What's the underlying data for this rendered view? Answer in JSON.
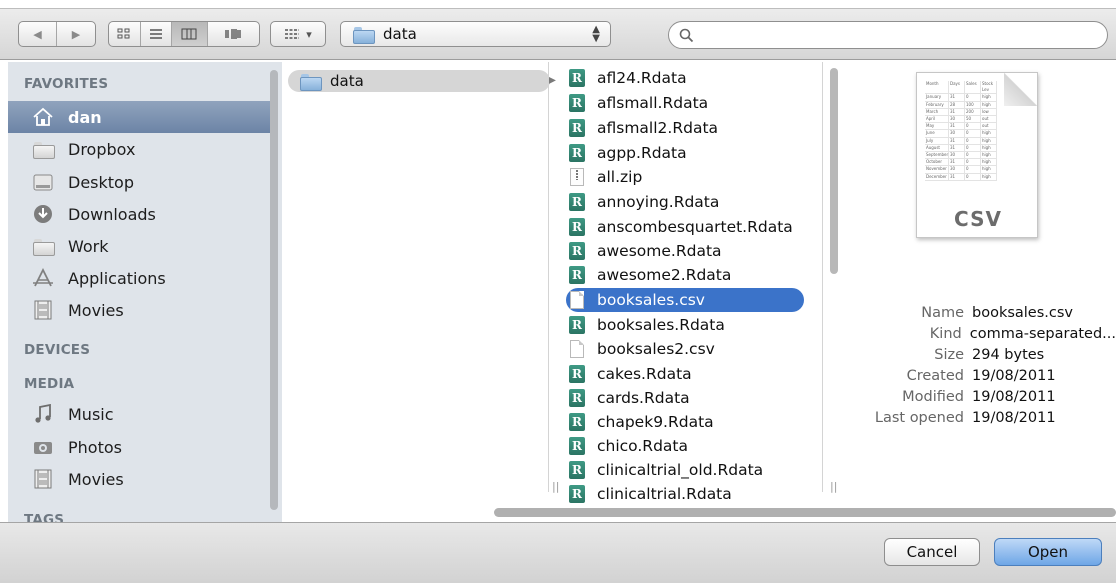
{
  "toolbar": {
    "nav_back_glyph": "◀",
    "nav_forward_glyph": "▶",
    "view_modes": [
      "icon",
      "list",
      "column",
      "coverflow"
    ],
    "active_view": "column",
    "arrange_glyph": "▾",
    "path_folder": "data",
    "search_value": "",
    "search_placeholder": ""
  },
  "sidebar": {
    "favorites_heading": "FAVORITES",
    "favorites": [
      {
        "label": "dan",
        "icon": "home-icon",
        "selected": true
      },
      {
        "label": "Dropbox",
        "icon": "folder-icon"
      },
      {
        "label": "Desktop",
        "icon": "desktop-icon"
      },
      {
        "label": "Downloads",
        "icon": "downloads-icon"
      },
      {
        "label": "Work",
        "icon": "folder-icon"
      },
      {
        "label": "Applications",
        "icon": "applications-icon"
      },
      {
        "label": "Movies",
        "icon": "movies-icon"
      }
    ],
    "devices_heading": "DEVICES",
    "media_heading": "MEDIA",
    "media": [
      {
        "label": "Music",
        "icon": "music-icon"
      },
      {
        "label": "Photos",
        "icon": "camera-icon"
      },
      {
        "label": "Movies",
        "icon": "movies-icon"
      }
    ],
    "tags_heading": "TAGS"
  },
  "columns": {
    "col1_folder": "data",
    "files": [
      {
        "name": "afl24.Rdata",
        "type": "rdata"
      },
      {
        "name": "aflsmall.Rdata",
        "type": "rdata"
      },
      {
        "name": "aflsmall2.Rdata",
        "type": "rdata"
      },
      {
        "name": "agpp.Rdata",
        "type": "rdata"
      },
      {
        "name": "all.zip",
        "type": "zip"
      },
      {
        "name": "annoying.Rdata",
        "type": "rdata"
      },
      {
        "name": "anscombesquartet.Rdata",
        "type": "rdata"
      },
      {
        "name": "awesome.Rdata",
        "type": "rdata"
      },
      {
        "name": "awesome2.Rdata",
        "type": "rdata"
      },
      {
        "name": "booksales.csv",
        "type": "doc",
        "selected": true
      },
      {
        "name": "booksales.Rdata",
        "type": "rdata"
      },
      {
        "name": "booksales2.csv",
        "type": "doc"
      },
      {
        "name": "cakes.Rdata",
        "type": "rdata"
      },
      {
        "name": "cards.Rdata",
        "type": "rdata"
      },
      {
        "name": "chapek9.Rdata",
        "type": "rdata"
      },
      {
        "name": "chico.Rdata",
        "type": "rdata"
      },
      {
        "name": "clinicaltrial_old.Rdata",
        "type": "rdata"
      },
      {
        "name": "clinicaltrial.Rdata",
        "type": "rdata"
      }
    ],
    "rdata_glyph": "R"
  },
  "preview": {
    "thumbnail_label": "CSV",
    "thumbnail_table": [
      [
        "Month",
        "Days",
        "Sales",
        "Stock Lev"
      ],
      [
        "January",
        "31",
        "0",
        "high"
      ],
      [
        "February",
        "28",
        "100",
        "high"
      ],
      [
        "March",
        "31",
        "200",
        "low"
      ],
      [
        "April",
        "30",
        "50",
        "out"
      ],
      [
        "May",
        "31",
        "0",
        "out"
      ],
      [
        "June",
        "30",
        "0",
        "high"
      ],
      [
        "July",
        "31",
        "0",
        "high"
      ],
      [
        "August",
        "31",
        "0",
        "high"
      ],
      [
        "September",
        "30",
        "0",
        "high"
      ],
      [
        "October",
        "31",
        "0",
        "high"
      ],
      [
        "November",
        "30",
        "0",
        "high"
      ],
      [
        "December",
        "31",
        "0",
        "high"
      ]
    ],
    "meta": [
      {
        "key": "Name",
        "value": "booksales.csv"
      },
      {
        "key": "Kind",
        "value": "comma-separated..."
      },
      {
        "key": "Size",
        "value": "294 bytes"
      },
      {
        "key": "Created",
        "value": "19/08/2011"
      },
      {
        "key": "Modified",
        "value": "19/08/2011"
      },
      {
        "key": "Last opened",
        "value": "19/08/2011"
      }
    ]
  },
  "footer": {
    "cancel_label": "Cancel",
    "open_label": "Open"
  },
  "colors": {
    "selection_blue": "#3b73c9",
    "sidebar_bg": "#dfe4ea",
    "rdata_teal": "#2b7463"
  }
}
